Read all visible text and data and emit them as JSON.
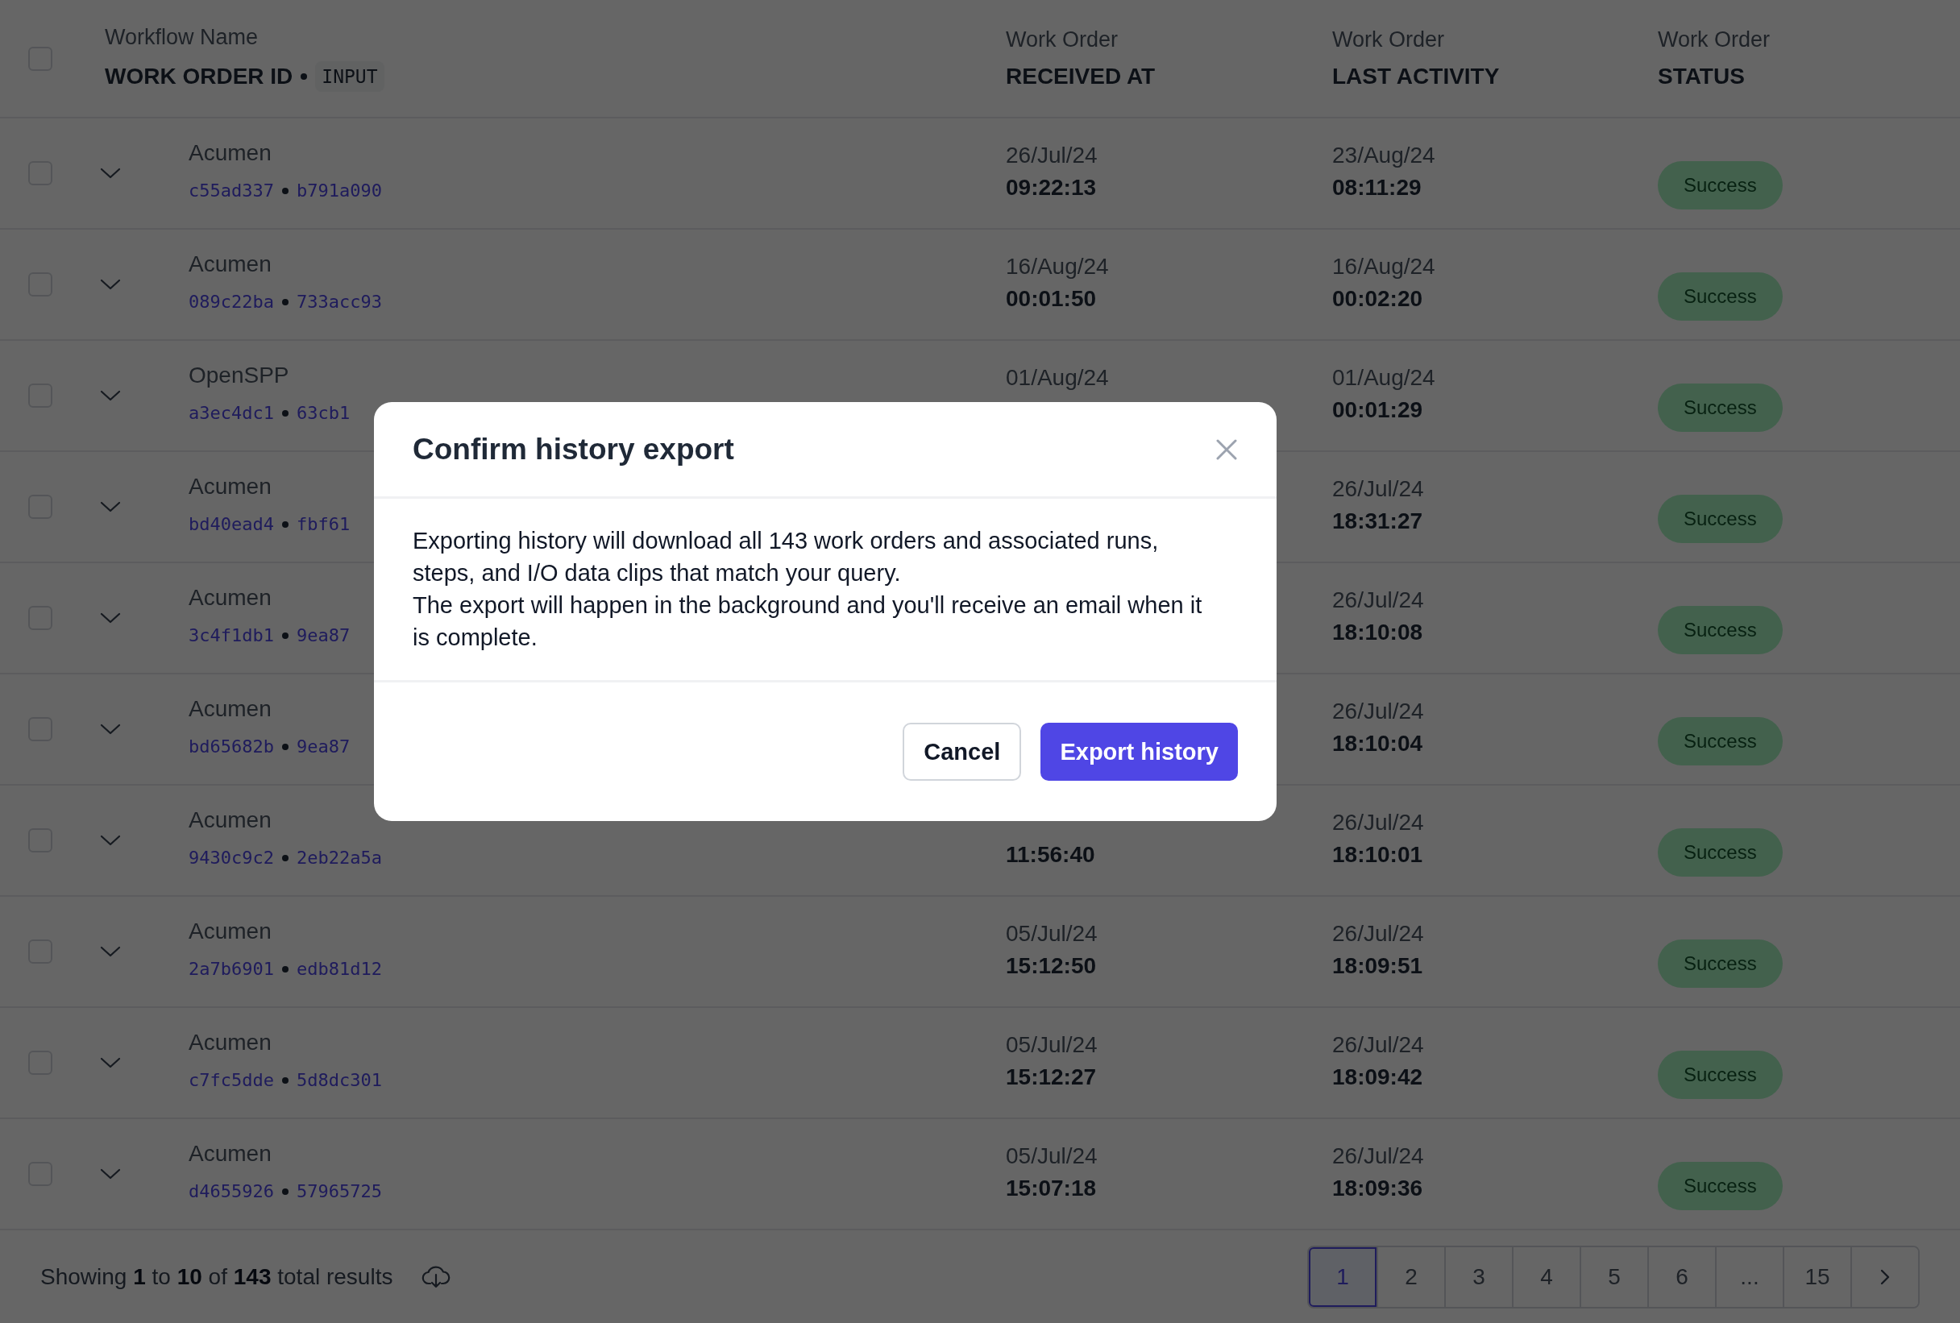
{
  "table": {
    "select_all": {
      "checked": false
    },
    "columns": [
      {
        "label": "Workflow Name",
        "sublabel": "WORK ORDER ID",
        "tag": "INPUT"
      },
      {
        "label": "Work Order",
        "sublabel": "RECEIVED AT"
      },
      {
        "label": "Work Order",
        "sublabel": "LAST ACTIVITY"
      },
      {
        "label": "Work Order",
        "sublabel": "STATUS"
      }
    ],
    "rows": [
      {
        "checked": false,
        "expanded": false,
        "workflow": "Acumen",
        "work_order_id": "c55ad337",
        "input_id": "b791a090",
        "received_date": "26/Jul/24",
        "received_time": "09:22:13",
        "last_date": "23/Aug/24",
        "last_time": "08:11:29",
        "status": "Success"
      },
      {
        "checked": false,
        "expanded": false,
        "workflow": "Acumen",
        "work_order_id": "089c22ba",
        "input_id": "733acc93",
        "received_date": "16/Aug/24",
        "received_time": "00:01:50",
        "last_date": "16/Aug/24",
        "last_time": "00:02:20",
        "status": "Success"
      },
      {
        "checked": false,
        "expanded": false,
        "workflow": "OpenSPP",
        "work_order_id": "a3ec4dc1",
        "input_id": "63cb1",
        "received_date": "01/Aug/24",
        "last_date": "01/Aug/24",
        "last_time": "00:01:29",
        "status": "Success"
      },
      {
        "checked": false,
        "expanded": false,
        "workflow": "Acumen",
        "work_order_id": "bd40ead4",
        "input_id": "fbf61",
        "last_date": "26/Jul/24",
        "last_time": "18:31:27",
        "status": "Success"
      },
      {
        "checked": false,
        "expanded": false,
        "workflow": "Acumen",
        "work_order_id": "3c4f1db1",
        "input_id": "9ea87",
        "last_date": "26/Jul/24",
        "last_time": "18:10:08",
        "status": "Success"
      },
      {
        "checked": false,
        "expanded": false,
        "workflow": "Acumen",
        "work_order_id": "bd65682b",
        "input_id": "9ea87",
        "last_date": "26/Jul/24",
        "last_time": "18:10:04",
        "status": "Success"
      },
      {
        "checked": false,
        "expanded": false,
        "workflow": "Acumen",
        "work_order_id": "9430c9c2",
        "input_id": "2eb22a5a",
        "received_time": "11:56:40",
        "last_date": "26/Jul/24",
        "last_time": "18:10:01",
        "status": "Success"
      },
      {
        "checked": false,
        "expanded": false,
        "workflow": "Acumen",
        "work_order_id": "2a7b6901",
        "input_id": "edb81d12",
        "received_date": "05/Jul/24",
        "received_time": "15:12:50",
        "last_date": "26/Jul/24",
        "last_time": "18:09:51",
        "status": "Success"
      },
      {
        "checked": false,
        "expanded": false,
        "workflow": "Acumen",
        "work_order_id": "c7fc5dde",
        "input_id": "5d8dc301",
        "received_date": "05/Jul/24",
        "received_time": "15:12:27",
        "last_date": "26/Jul/24",
        "last_time": "18:09:42",
        "status": "Success"
      },
      {
        "checked": false,
        "expanded": false,
        "workflow": "Acumen",
        "work_order_id": "d4655926",
        "input_id": "57965725",
        "received_date": "05/Jul/24",
        "received_time": "15:07:18",
        "last_date": "26/Jul/24",
        "last_time": "18:09:36",
        "status": "Success"
      }
    ]
  },
  "footer": {
    "summary": "Showing **1** to **10** of **143** total results",
    "pages": [
      {
        "label": "1",
        "selected": true
      },
      {
        "label": "2",
        "selected": false
      },
      {
        "label": "3",
        "selected": false
      },
      {
        "label": "4",
        "selected": false
      },
      {
        "label": "5",
        "selected": false
      },
      {
        "label": "6",
        "selected": false
      },
      {
        "label": "...",
        "selected": false
      },
      {
        "label": "15",
        "selected": false
      }
    ]
  },
  "dialog": {
    "title": "Confirm history export",
    "paragraphs": [
      "Exporting history will download all 143 work orders and associated runs, steps, and I/O data clips that match your query.",
      "The export will happen in the background and you'll receive an email when it is complete."
    ],
    "cancel_button": "Cancel",
    "confirm_button": "Export history"
  }
}
